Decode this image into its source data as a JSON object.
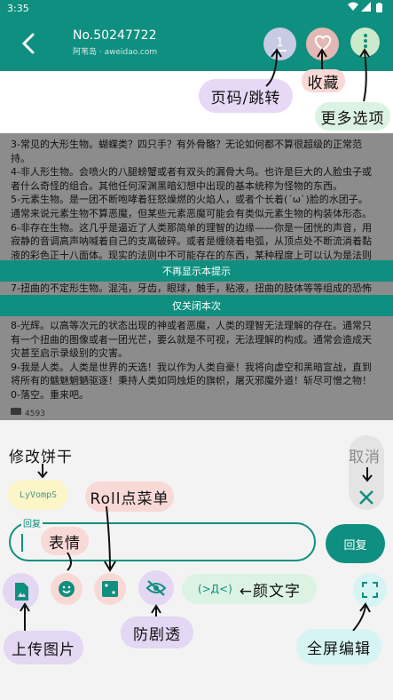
{
  "status_bar": {
    "time": "3:35"
  },
  "header": {
    "title": "No.50247722",
    "subtitle": "阿苇岛 · aweidao.com",
    "page_number": "1"
  },
  "thread": {
    "lines_top": [
      "3-常见的大形生物。蝴蝶类？四只手？有外骨骼？无论如何都不算很超级的正常范",
      "持。",
      "4-非人形生物。会喷火的八腿螃蟹或者有双头的漏骨大鸟。也许是巨大的人脸虫子或",
      "者什么奇怪的组合。其他任何深渊黑暗幻想中出现的基本统称为怪物的东西。",
      "5-元素生物。是一团不断咆哮着狂怒燥燃的火焰人，或者个长着(ˊωˋ)脸的水团子。",
      "通常来说元素生物不算恶魔，但某些元素恶魔可能会有类似元素生物的构装体形态。",
      "6-非存在生物。这几乎是逼近了人类那简单的理智的边缘——你是一团恍的声音，用",
      "寂静的音调高声呐喊着自己的支离破碎。或者是缠绕着电弧，从顶点处不断流淌着黏",
      "液的彩色正十八面体。现实的法则中不可能存在的东西，某种程度上可以认为是法则",
      "7-扭曲的不定形生物。混沌，牙齿，眼球，触手，粘液，扭曲的肢体等等组成的恐怖"
    ],
    "lines_bottom": [
      "8-光辉。以高等次元的状态出现的神或者恶魔，人类的理智无法理解的存在。通常只",
      "有一个扭曲的图像或者一团光芒，要么就是不可视，无法理解的构成。通常会造成天",
      "灾甚至启示录级别的灾害。",
      "9-我是人类。人类是世界的天选！我以作为人类自豪！我将向虚空和黑暗宣战，直到",
      "将所有的魑魅魍魉驱逐！秉持人类如同烛炬的旗帜，屠灭邪魔外道！斩尽可憎之物！",
      "0-落空。重来吧。"
    ],
    "reply_count": "4593"
  },
  "banners": {
    "never_show": "不再显示本提示",
    "close_once": "仅关闭本次"
  },
  "tips": {
    "page_jump": "页码/跳转",
    "favorite": "收藏",
    "more_options": "更多选项",
    "edit_cookie": "修改饼干",
    "cancel": "取消",
    "roll_menu": "Roll点菜单",
    "emoji": "表情",
    "kaomoji": "←颜文字",
    "upload_image": "上传图片",
    "anti_spoiler": "防剧透",
    "fullscreen_edit": "全屏编辑"
  },
  "composer": {
    "cookie": "LyVompS",
    "field_label": "回复",
    "input_value": "",
    "send_label": "回复",
    "kaomoji_button": "(>Д<)"
  },
  "colors": {
    "accent": "#0f8f7f",
    "tip_purple": "#e7d8f6",
    "tip_green": "#dcf3e3",
    "tip_pink": "#f9d9d6",
    "tip_yellow": "#fbf5c8",
    "tip_cyan": "#d6f4f4"
  }
}
